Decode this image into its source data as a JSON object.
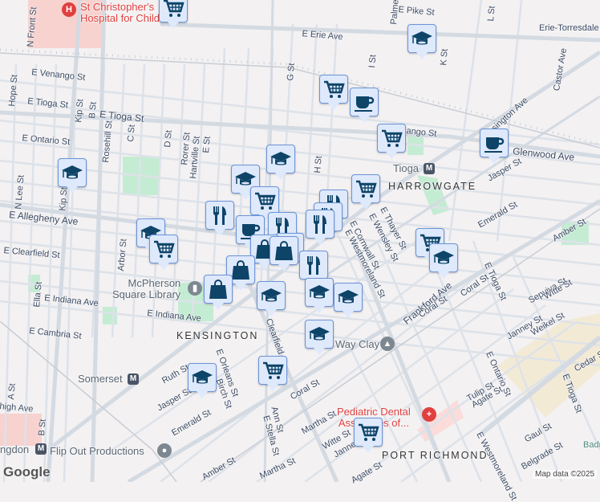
{
  "map": {
    "attribution": "Map data ©2025",
    "logo": "Google",
    "colors": {
      "marker_fill": "#dfe9fc",
      "marker_border": "#6b95d8",
      "icon": "#0d4468",
      "park": "#c4ecd3",
      "hospital_area": "#f7d2cf",
      "industrial": "#f3ead6",
      "road": "#d7dde5"
    }
  },
  "places": {
    "hospital": "St Christopher's Hospital for Children",
    "hospital_line1": "St Christopher's",
    "hospital_line2": "Hospital for Children",
    "library_line1": "McPherson",
    "library_line2": "Square Library",
    "dental_line1": "Pediatric Dental",
    "dental_line2": "Associates of...",
    "flipout": "Flip Out Productions",
    "wayclay": "Way Clay",
    "tioga_station": "Tioga",
    "somerset_station": "Somerset",
    "huntingdon_station": "ngdon",
    "badr": "Badr"
  },
  "neighborhoods": [
    "HARROWGATE",
    "KENSINGTON",
    "PORT RICHMOND"
  ],
  "streets": [
    "N Front St",
    "E Venango St",
    "E Tioga St",
    "E Tioga St",
    "E Ontario St",
    "Kip St",
    "B St",
    "Rosehill St",
    "C St",
    "D St",
    "Rorer St",
    "Hartville St",
    "E St",
    "G St",
    "H St",
    "I St",
    "K St",
    "L St",
    "E Pike St",
    "Palmer St",
    "E Erie Ave",
    "Erie-Torresdale",
    "Castor Ave",
    "Kensington Ave",
    "Glenwood Ave",
    "Jasper St",
    "E Venango St",
    "Emerald St",
    "Amber St",
    "E Allegheny Ave",
    "E Clearfield St",
    "Arbor St",
    "E Indiana Ave",
    "E Indiana Ave",
    "E Cambria St",
    "Ella St",
    "N Lee St",
    "Hope St",
    "Ruth St",
    "E Orleans St",
    "Birch St",
    "Jasper St",
    "Emerald St",
    "Clearfield St",
    "Coral St",
    "Ann St",
    "E Stella St",
    "Martha St",
    "Amber St",
    "Frankford Ave",
    "Coral St",
    "Coral St",
    "E Tioga St",
    "Sepviva St",
    "Witte St",
    "Janney St",
    "Weikel St",
    "E Ontario St",
    "Tulip St",
    "Agate St",
    "Cedar St",
    "E Tioga St",
    "Gaul St",
    "Belgrade St",
    "E Westmoreland St",
    "E Westmoreland St",
    "E Cornwall St",
    "E Wensley St",
    "E Thayer St",
    "Martha St",
    "Witte St",
    "Janney St",
    "Agate St",
    "Kip St",
    "A St",
    "B St",
    "high Ave"
  ],
  "markers": [
    {
      "icon": "cart-icon"
    },
    {
      "icon": "graduation-cap-icon"
    },
    {
      "icon": "cart-icon"
    },
    {
      "icon": "coffee-cup-icon"
    },
    {
      "icon": "cart-icon"
    },
    {
      "icon": "coffee-cup-icon"
    },
    {
      "icon": "graduation-cap-icon"
    },
    {
      "icon": "graduation-cap-icon"
    },
    {
      "icon": "cart-icon"
    },
    {
      "icon": "cart-icon"
    },
    {
      "icon": "fork-knife-icon"
    },
    {
      "icon": "fork-knife-icon"
    },
    {
      "icon": "fork-knife-icon"
    },
    {
      "icon": "fork-knife-icon"
    },
    {
      "icon": "coffee-cup-icon"
    },
    {
      "icon": "fork-knife-icon"
    },
    {
      "icon": "shopping-bag-icon"
    },
    {
      "icon": "shopping-bag-icon"
    },
    {
      "icon": "shopping-bag-icon"
    },
    {
      "icon": "shopping-bag-icon"
    },
    {
      "icon": "shopping-bag-icon"
    },
    {
      "icon": "graduation-cap-icon"
    },
    {
      "icon": "cart-icon"
    },
    {
      "icon": "graduation-cap-icon"
    },
    {
      "icon": "cart-icon"
    },
    {
      "icon": "graduation-cap-icon"
    },
    {
      "icon": "fork-knife-icon"
    },
    {
      "icon": "graduation-cap-icon"
    },
    {
      "icon": "graduation-cap-icon"
    },
    {
      "icon": "graduation-cap-icon"
    },
    {
      "icon": "graduation-cap-icon"
    },
    {
      "icon": "cart-icon"
    },
    {
      "icon": "graduation-cap-icon"
    },
    {
      "icon": "cart-icon"
    }
  ]
}
